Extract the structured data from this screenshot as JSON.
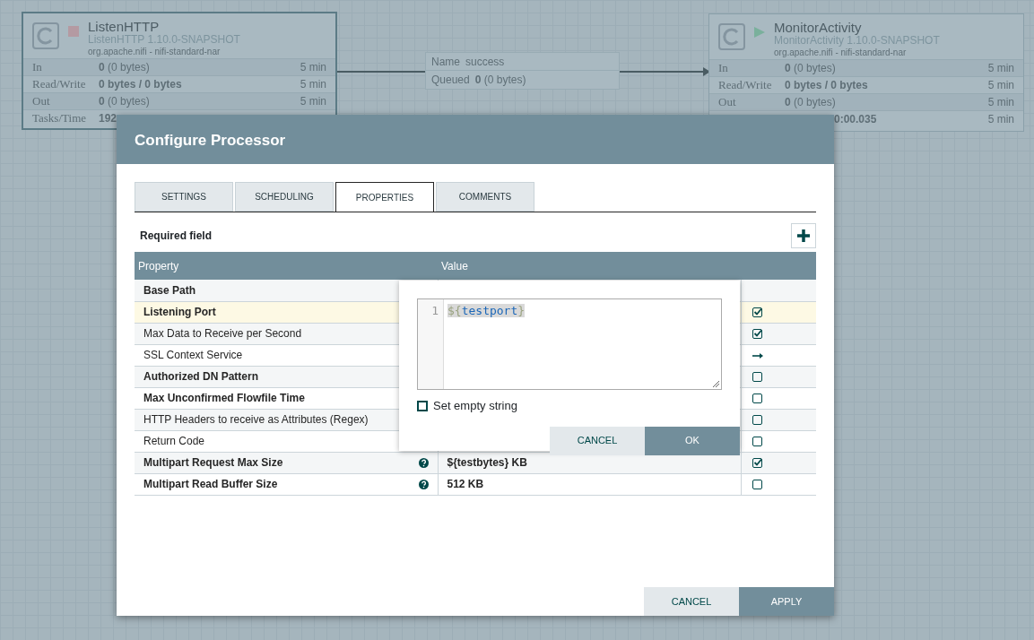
{
  "canvas": {
    "processors": [
      {
        "name": "ListenHTTP",
        "type": "ListenHTTP 1.10.0-SNAPSHOT",
        "bundle": "org.apache.nifi - nifi-standard-nar",
        "running": false,
        "selected": true,
        "stats": [
          {
            "label": "In",
            "count": "0",
            "detail": "(0 bytes)",
            "window": "5 min"
          },
          {
            "label": "Read/Write",
            "count": "0 bytes / 0 bytes",
            "window": "5 min"
          },
          {
            "label": "Out",
            "count": "0",
            "detail": "(0 bytes)",
            "window": "5 min"
          },
          {
            "label": "Tasks/Time",
            "count": "192"
          }
        ]
      },
      {
        "name": "MonitorActivity",
        "type": "MonitorActivity 1.10.0-SNAPSHOT",
        "bundle": "org.apache.nifi - nifi-standard-nar",
        "running": true,
        "selected": false,
        "stats": [
          {
            "label": "In",
            "count": "0",
            "detail": "(0 bytes)",
            "window": "5 min"
          },
          {
            "label": "Read/Write",
            "count": "0 bytes / 0 bytes",
            "window": "5 min"
          },
          {
            "label": "Out",
            "count": "0",
            "detail": "(0 bytes)",
            "window": "5 min"
          },
          {
            "count": "0:00.035",
            "window": "5 min"
          }
        ]
      }
    ],
    "connection": {
      "name_label": "Name",
      "name": "success",
      "queued_label": "Queued",
      "queued_count": "0",
      "queued_detail": "(0 bytes)"
    }
  },
  "dialog": {
    "title": "Configure Processor",
    "tabs": [
      {
        "label": "SETTINGS",
        "selected": false
      },
      {
        "label": "SCHEDULING",
        "selected": false
      },
      {
        "label": "PROPERTIES",
        "selected": true
      },
      {
        "label": "COMMENTS",
        "selected": false
      }
    ],
    "required_label": "Required field",
    "columns": [
      "Property",
      "Value"
    ],
    "rows": [
      {
        "name": "Base Path",
        "required": true,
        "highlighted": false,
        "help": false
      },
      {
        "name": "Listening Port",
        "required": true,
        "highlighted": true,
        "help": false,
        "kind": "checked"
      },
      {
        "name": "Max Data to Receive per Second",
        "required": false,
        "highlighted": false,
        "help": false,
        "kind": "checked"
      },
      {
        "name": "SSL Context Service",
        "required": false,
        "highlighted": false,
        "help": false,
        "kind": "arrow"
      },
      {
        "name": "Authorized DN Pattern",
        "required": true,
        "highlighted": false,
        "help": false,
        "kind": "unchecked"
      },
      {
        "name": "Max Unconfirmed Flowfile Time",
        "required": true,
        "highlighted": false,
        "help": false,
        "kind": "unchecked"
      },
      {
        "name": "HTTP Headers to receive as Attributes (Regex)",
        "required": false,
        "highlighted": false,
        "help": false,
        "kind": "unchecked"
      },
      {
        "name": "Return Code",
        "required": false,
        "highlighted": false,
        "help": false,
        "kind": "unchecked"
      },
      {
        "name": "Multipart Request Max Size",
        "required": true,
        "highlighted": false,
        "help": true,
        "value": "${testbytes} KB",
        "kind": "checked"
      },
      {
        "name": "Multipart Read Buffer Size",
        "required": true,
        "highlighted": false,
        "help": true,
        "value": "512 KB",
        "kind": "unchecked"
      }
    ],
    "editor": {
      "line_number": "1",
      "prefix": "${",
      "variable": "testport",
      "suffix": "}",
      "empty_string": {
        "label": "Set empty string",
        "checked": false
      },
      "buttons": [
        {
          "label": "CANCEL",
          "kind": "secondary"
        },
        {
          "label": "OK",
          "kind": "primary"
        }
      ]
    },
    "buttons": [
      {
        "label": "CANCEL",
        "kind": "secondary"
      },
      {
        "label": "APPLY",
        "kind": "primary"
      }
    ]
  }
}
